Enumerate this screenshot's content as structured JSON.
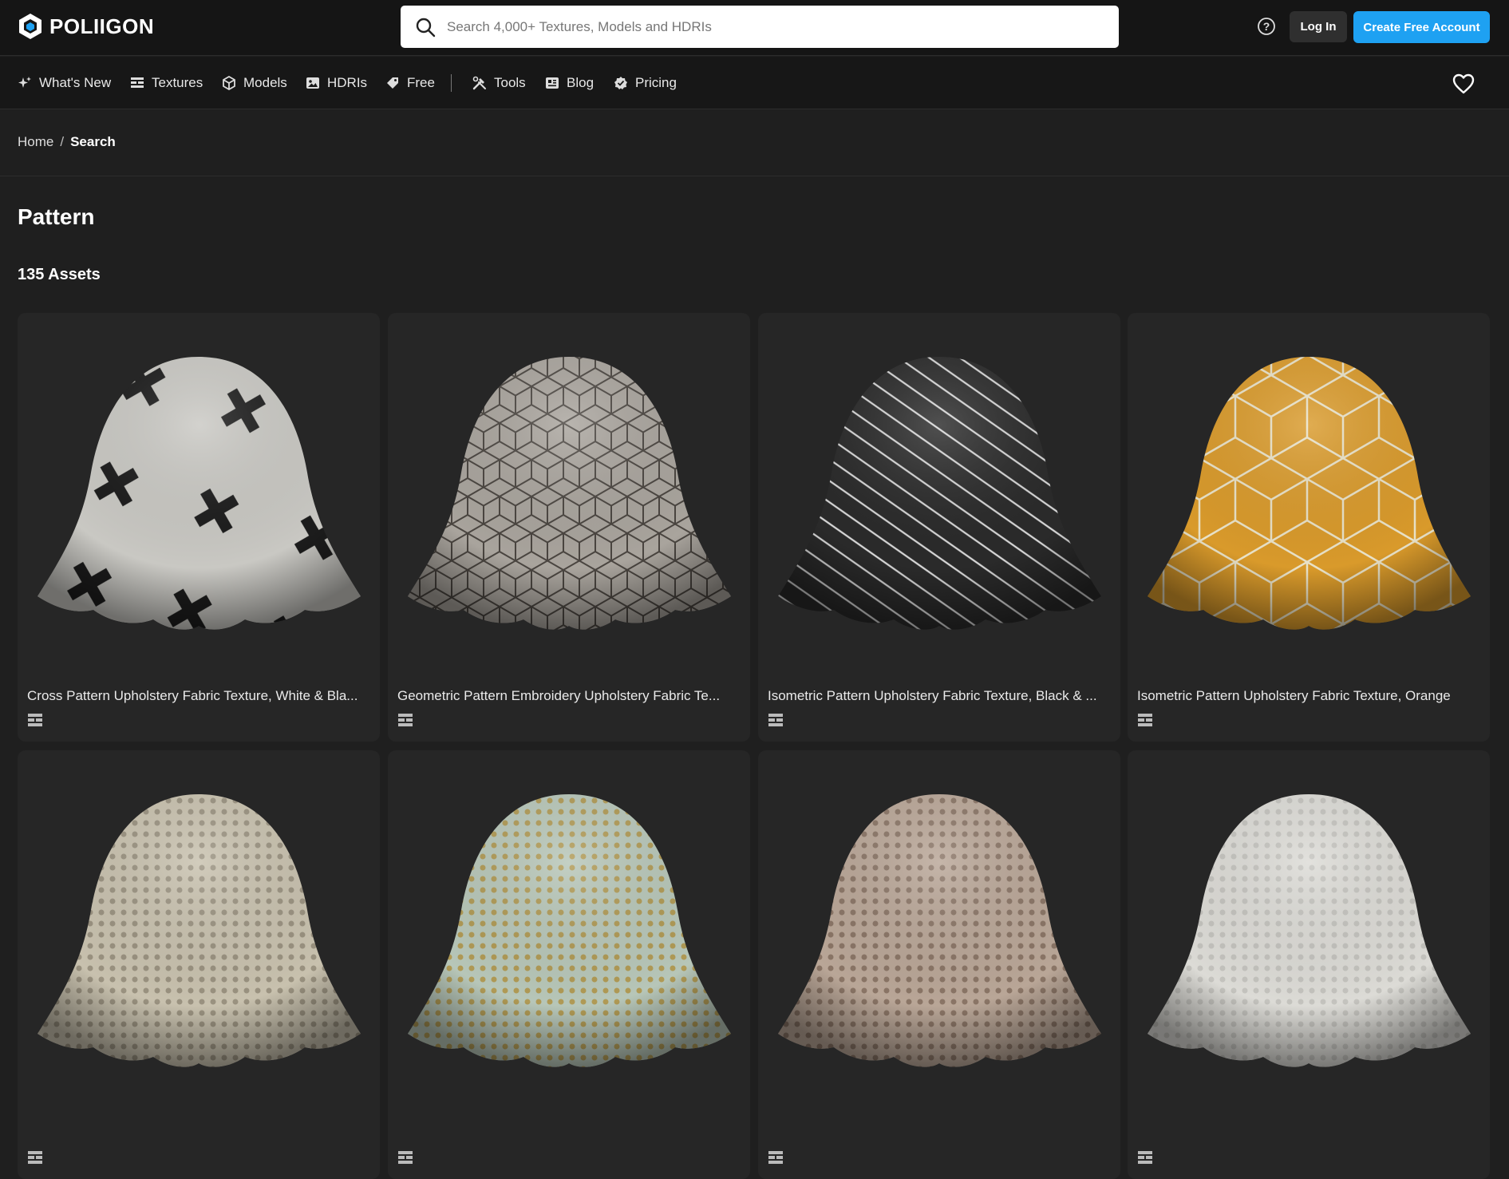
{
  "header": {
    "logo_text": "POLIIGON",
    "search_placeholder": "Search 4,000+ Textures, Models and HDRIs",
    "help_icon": "question-circle-icon",
    "login_label": "Log In",
    "signup_label": "Create Free Account",
    "accent_color": "#1ea1f2"
  },
  "nav": {
    "items": [
      {
        "label": "What's New",
        "icon": "sparkle-icon"
      },
      {
        "label": "Textures",
        "icon": "texture-grid-icon"
      },
      {
        "label": "Models",
        "icon": "cube-icon"
      },
      {
        "label": "HDRIs",
        "icon": "image-icon"
      },
      {
        "label": "Free",
        "icon": "tag-icon"
      },
      {
        "label": "Tools",
        "icon": "tools-icon"
      },
      {
        "label": "Blog",
        "icon": "newspaper-icon"
      },
      {
        "label": "Pricing",
        "icon": "badge-check-icon"
      }
    ],
    "favorites_icon": "heart-icon"
  },
  "breadcrumb": {
    "home": "Home",
    "separator": "/",
    "current": "Search"
  },
  "page": {
    "title": "Pattern",
    "asset_count": "135 Assets"
  },
  "assets": [
    {
      "title": "Cross Pattern Upholstery Fabric Texture, White & Bla...",
      "type_icon": "texture-icon",
      "fabric_color": "#c9c8c3",
      "pattern_color": "#1c1c1c"
    },
    {
      "title": "Geometric Pattern Embroidery Upholstery Fabric Te...",
      "type_icon": "texture-icon",
      "fabric_color": "#a9a49d",
      "pattern_color": "#4a4540"
    },
    {
      "title": "Isometric Pattern Upholstery Fabric Texture, Black & ...",
      "type_icon": "texture-icon",
      "fabric_color": "#2a2a2a",
      "pattern_color": "#d8d8d8"
    },
    {
      "title": "Isometric Pattern Upholstery Fabric Texture, Orange",
      "type_icon": "texture-icon",
      "fabric_color": "#d99a2b",
      "pattern_color": "#e9e2c8"
    },
    {
      "title": "",
      "type_icon": "texture-icon",
      "fabric_color": "#c8c1ae",
      "pattern_color": "#9a9280"
    },
    {
      "title": "",
      "type_icon": "texture-icon",
      "fabric_color": "#b7c6b8",
      "pattern_color": "#b09a55"
    },
    {
      "title": "",
      "type_icon": "texture-icon",
      "fabric_color": "#b9a697",
      "pattern_color": "#8a7566"
    },
    {
      "title": "",
      "type_icon": "texture-icon",
      "fabric_color": "#dcdbd6",
      "pattern_color": "#c4c3be"
    }
  ]
}
